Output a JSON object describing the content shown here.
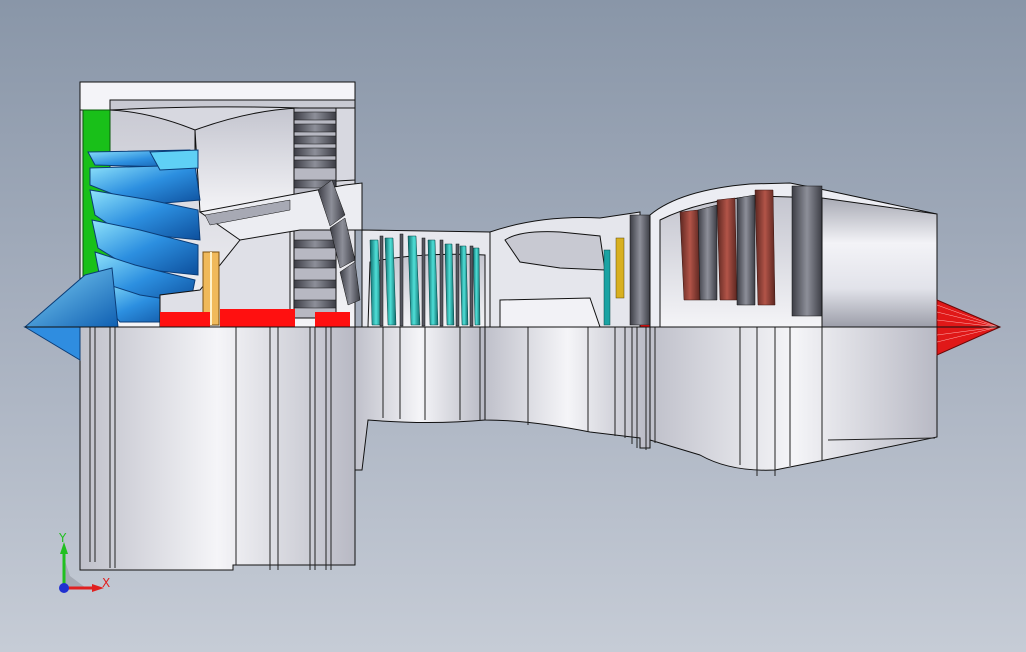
{
  "scene": {
    "background_top": "#8996a8",
    "background_bottom": "#c6ccd6",
    "subject": "turbofan-engine-cutaway",
    "view": "front-plane-section"
  },
  "colors": {
    "casing": "#e6e7ee",
    "casing_shadow": "#8b8d99",
    "fan_blade": "#1e6fc8",
    "fan_blade_light": "#63c6f2",
    "spinner": "#2f8de0",
    "inlet_guide": "#19c019",
    "support_strut": "#f0b95a",
    "section_cut": "#ff1010",
    "compressor_blade": "#1aa3a3",
    "combustor_igniter": "#d8b020",
    "turbine_blade": "#8a3b32",
    "exhaust_cone": "#e01818",
    "outline": "#111111"
  },
  "triad": {
    "x_label": "X",
    "y_label": "Y",
    "x_color": "#e02020",
    "y_color": "#20c020",
    "origin_color": "#2030d0",
    "icon": "coordinate-triad-icon"
  }
}
